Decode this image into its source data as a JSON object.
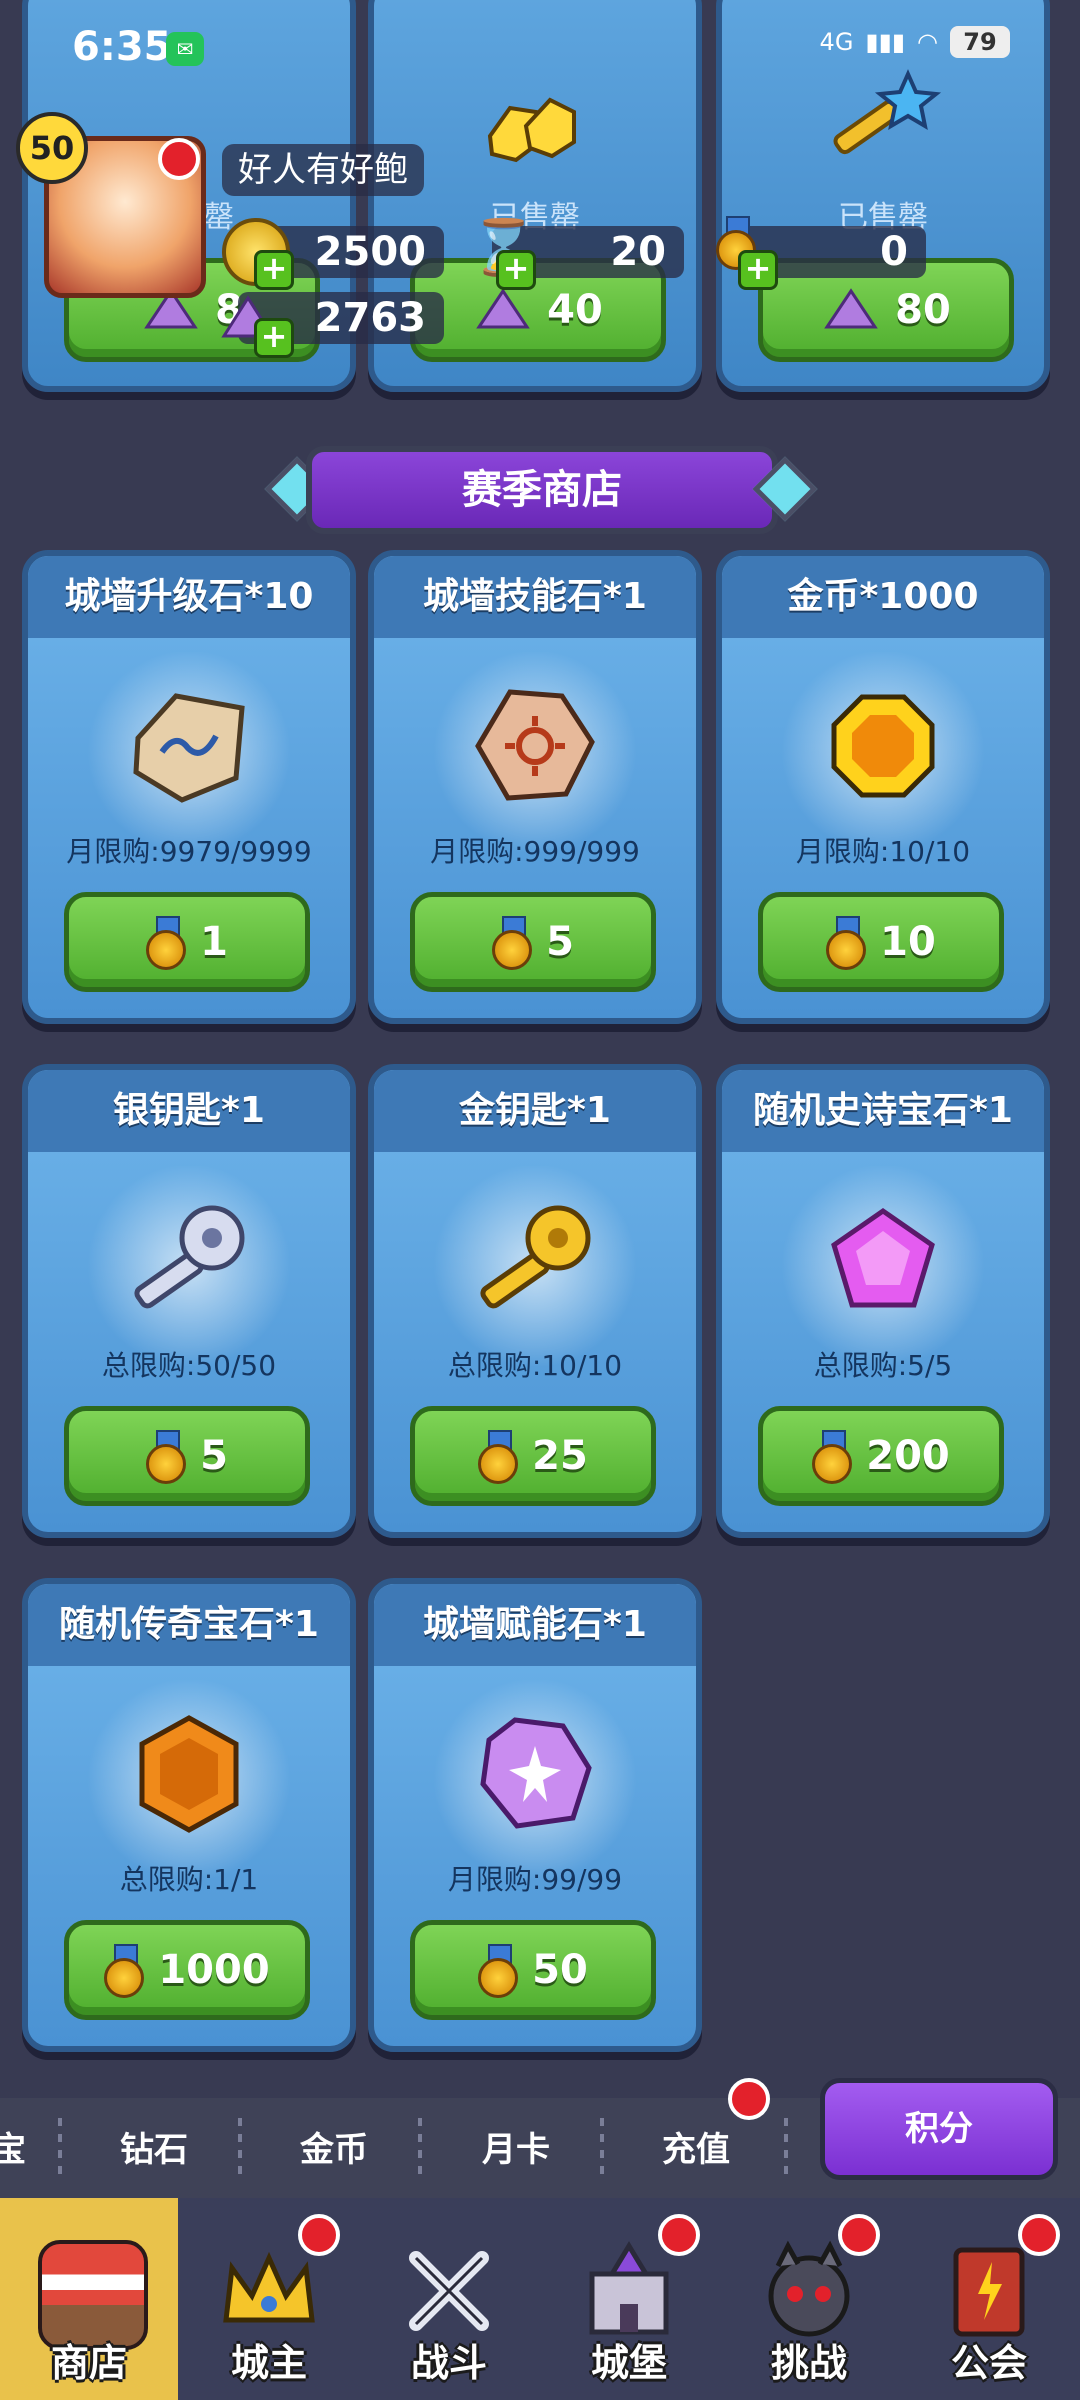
{
  "status_bar": {
    "time": "6:35",
    "network": "4G",
    "battery": "79"
  },
  "profile": {
    "level": "50",
    "nickname": "好人有好鲍"
  },
  "resources": [
    {
      "name": "coin",
      "value": "2500"
    },
    {
      "name": "hourglass",
      "value": "20"
    },
    {
      "name": "medal",
      "value": "0"
    },
    {
      "name": "gem",
      "value": "2763"
    }
  ],
  "top_cards": [
    {
      "sold_label": "已售罄",
      "price": "8"
    },
    {
      "sold_label": "已售罄",
      "price": "40"
    },
    {
      "sold_label": "已售罄",
      "price": "80"
    }
  ],
  "section_title": "赛季商店",
  "items": [
    {
      "title": "城墙升级石*10",
      "limit": "月限购:9979/9999",
      "price": "1",
      "icon": "rune-stone-icon"
    },
    {
      "title": "城墙技能石*1",
      "limit": "月限购:999/999",
      "price": "5",
      "icon": "sun-stone-icon"
    },
    {
      "title": "金币*1000",
      "limit": "月限购:10/10",
      "price": "10",
      "icon": "gold-coin-icon"
    },
    {
      "title": "银钥匙*1",
      "limit": "总限购:50/50",
      "price": "5",
      "icon": "silver-key-icon"
    },
    {
      "title": "金钥匙*1",
      "limit": "总限购:10/10",
      "price": "25",
      "icon": "gold-key-icon"
    },
    {
      "title": "随机史诗宝石*1",
      "limit": "总限购:5/5",
      "price": "200",
      "icon": "epic-gem-icon"
    },
    {
      "title": "随机传奇宝石*1",
      "limit": "总限购:1/1",
      "price": "1000",
      "icon": "legendary-gem-icon"
    },
    {
      "title": "城墙赋能石*1",
      "limit": "月限购:99/99",
      "price": "50",
      "icon": "empower-stone-icon"
    }
  ],
  "tabs": {
    "partial": "宝",
    "diamond": "钻石",
    "gold": "金币",
    "monthly": "月卡",
    "recharge": "充值",
    "points": "积分"
  },
  "nav": [
    {
      "label": "商店"
    },
    {
      "label": "城主"
    },
    {
      "label": "战斗"
    },
    {
      "label": "城堡"
    },
    {
      "label": "挑战"
    },
    {
      "label": "公会"
    }
  ],
  "colors": {
    "background": "#383a52",
    "card_blue": "#5fa6df",
    "button_green": "#66c23d",
    "accent_purple": "#7b30d2",
    "nav_active": "#e9c24b"
  }
}
